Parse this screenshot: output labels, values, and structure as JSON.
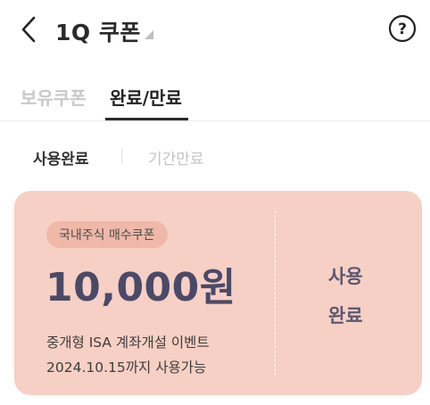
{
  "header": {
    "title": "1Q 쿠폰",
    "back_icon": "chevron-left-icon",
    "help_icon": "help-circle-icon"
  },
  "tabs": [
    {
      "label": "보유쿠폰",
      "active": false
    },
    {
      "label": "완료/만료",
      "active": true
    }
  ],
  "filters": [
    {
      "label": "사용완료",
      "active": true
    },
    {
      "label": "기간만료",
      "active": false
    }
  ],
  "coupon": {
    "badge": "국내주식 매수쿠폰",
    "amount": "10,000원",
    "description": "중개형 ISA 계좌개설 이벤트",
    "validity": "2024.10.15까지 사용가능",
    "status_line1": "사용",
    "status_line2": "완료",
    "card_color": "#f6d0c4",
    "badge_color": "#f0b8a8"
  }
}
